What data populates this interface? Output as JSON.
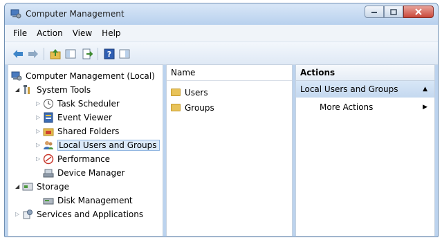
{
  "window": {
    "title": "Computer Management"
  },
  "menu": [
    "File",
    "Action",
    "View",
    "Help"
  ],
  "toolbar": {
    "icons": [
      "back-arrow-icon",
      "forward-arrow-icon",
      "up-folder-icon",
      "show-hide-tree-icon",
      "export-list-icon",
      "help-icon",
      "properties-icon"
    ]
  },
  "tree": {
    "root": "Computer Management (Local)",
    "system_tools": "System Tools",
    "task_scheduler": "Task Scheduler",
    "event_viewer": "Event Viewer",
    "shared_folders": "Shared Folders",
    "local_users_groups": "Local Users and Groups",
    "performance": "Performance",
    "device_manager": "Device Manager",
    "storage": "Storage",
    "disk_management": "Disk Management",
    "services_apps": "Services and Applications"
  },
  "list": {
    "column_name": "Name",
    "items": [
      "Users",
      "Groups"
    ]
  },
  "actions": {
    "header": "Actions",
    "group": "Local Users and Groups",
    "more": "More Actions"
  },
  "colors": {
    "selection": "#dceaf9",
    "titlebar": "#c9dcf2",
    "close_button": "#c9483a"
  }
}
